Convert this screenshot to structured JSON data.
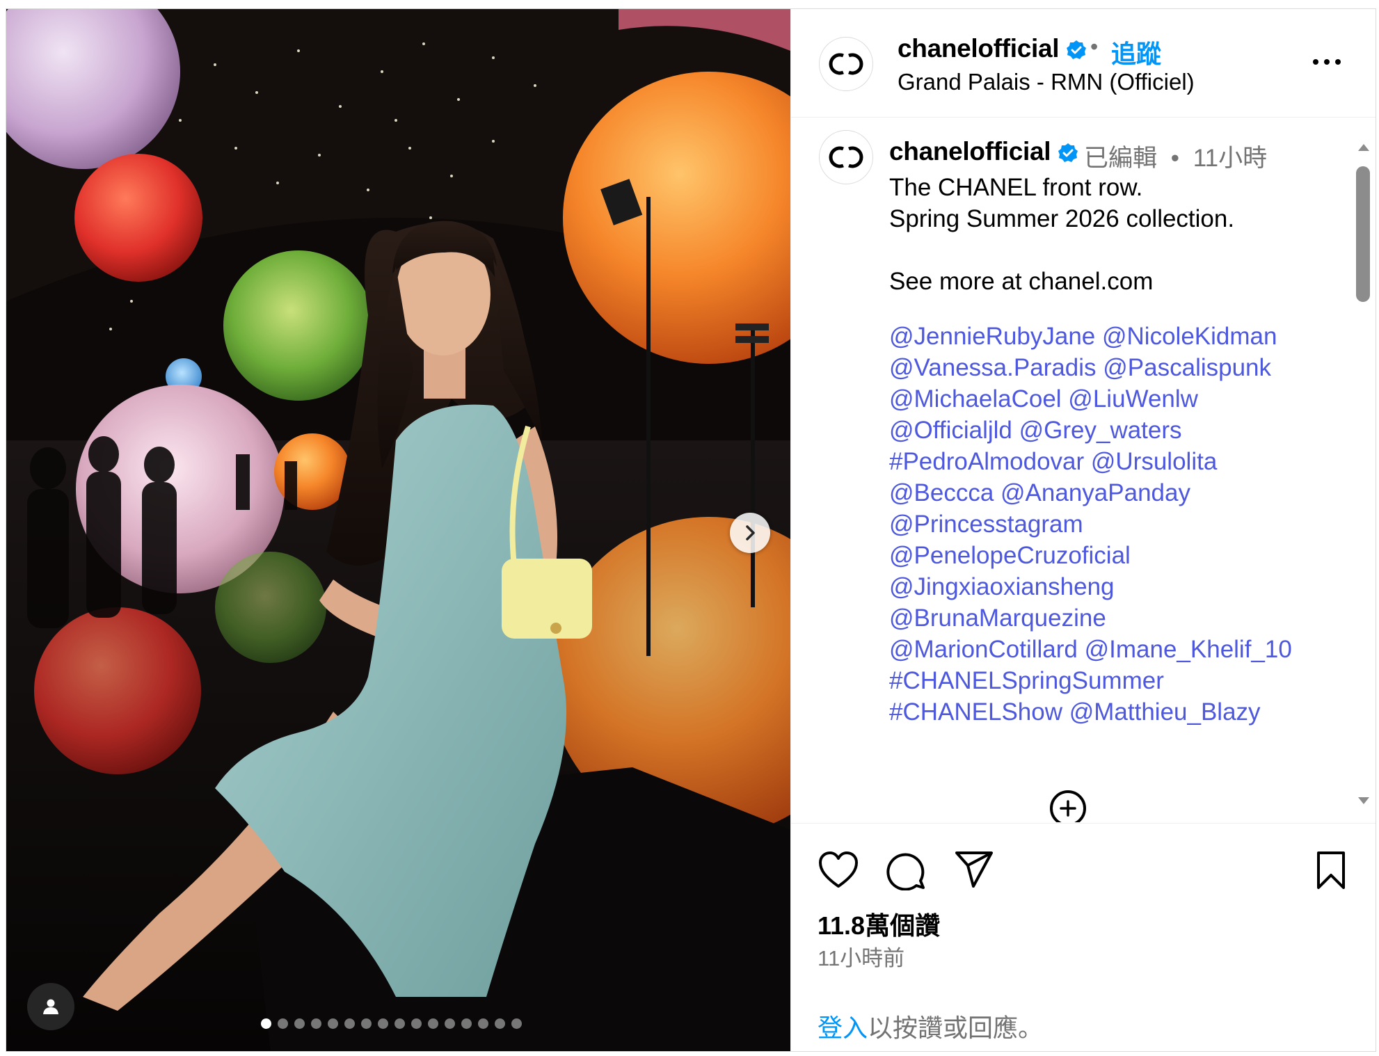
{
  "post": {
    "username": "chanelofficial",
    "follow_label": "追蹤",
    "location": "Grand Palais - RMN (Officiel)",
    "separator": "•"
  },
  "caption": {
    "edited_label": "已編輯",
    "separator": "•",
    "time_ago": "11小時",
    "text": "The CHANEL front row.\nSpring Summer 2026 collection.\n\nSee more at chanel.com",
    "tag_lines": [
      "@JennieRubyJane @NicoleKidman",
      "@Vanessa.Paradis @Pascalispunk",
      "@MichaelaCoel @LiuWenlw",
      "@Officialjld @Grey_waters",
      "#PedroAlmodovar @Ursulolita",
      "@Beccca @AnanyaPanday",
      "@Princesstagram",
      "@PenelopeCruzoficial",
      "@Jingxiaoxiansheng",
      "@BrunaMarquezine",
      "@MarionCotillard @Imane_Khelif_10",
      "#CHANELSpringSummer",
      "#CHANELShow @Matthieu_Blazy"
    ]
  },
  "engagement": {
    "likes": "11.8萬個讚",
    "posted": "11小時前",
    "login_link": "登入",
    "login_rest": "以按讚或回應。"
  },
  "carousel": {
    "slide_count": 16,
    "active_index": 0
  },
  "icons": {
    "verified": "verified-badge-icon",
    "more": "more-options-icon",
    "next": "chevron-right-icon",
    "tag": "user-tag-icon",
    "like": "heart-icon",
    "comment": "comment-icon",
    "share": "paper-plane-icon",
    "save": "bookmark-icon",
    "add": "plus-circle-icon"
  },
  "colors": {
    "link": "#0095f6",
    "tags": "#4d58dd",
    "muted": "#737373",
    "verified": "#0095f6"
  }
}
